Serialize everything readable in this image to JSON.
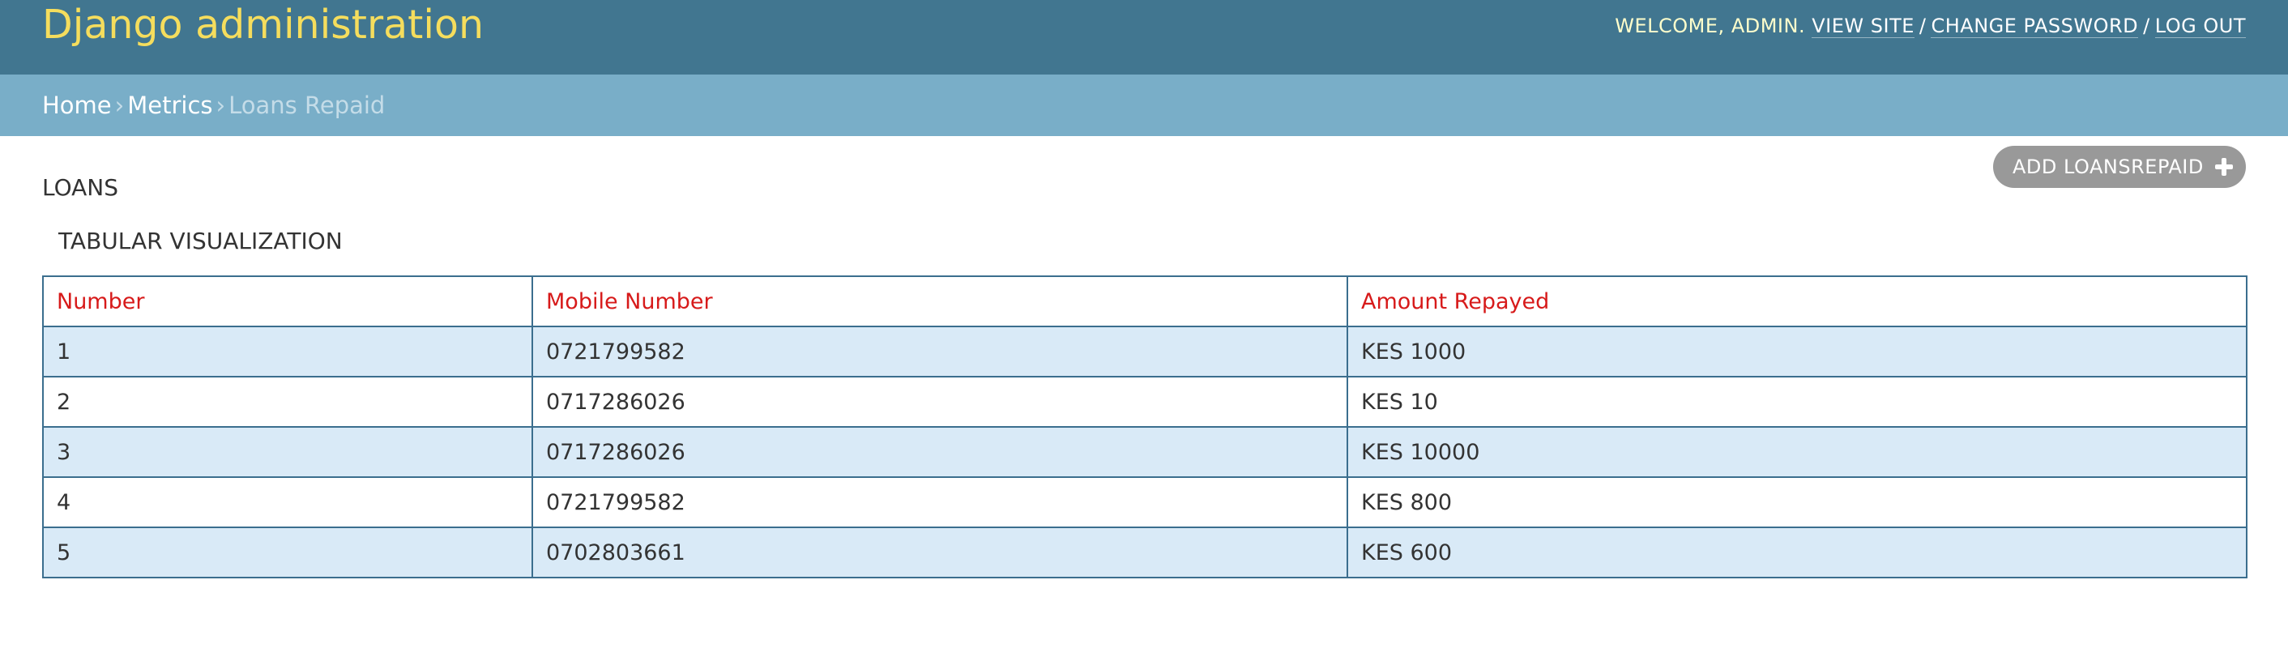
{
  "header": {
    "branding": "Django administration",
    "welcome": "WELCOME,",
    "username": "ADMIN.",
    "view_site": "VIEW SITE",
    "change_password": "CHANGE PASSWORD",
    "log_out": "LOG OUT",
    "separator": "/"
  },
  "breadcrumbs": {
    "home": "Home",
    "metrics": "Metrics",
    "current": "Loans Repaid",
    "separator": "›"
  },
  "toolbar": {
    "add_label": "ADD LOANSREPAID",
    "add_icon": "plus-icon"
  },
  "content": {
    "section_title": "LOANS",
    "sub_title": "TABULAR VISUALIZATION"
  },
  "table": {
    "headers": [
      "Number",
      "Mobile Number",
      "Amount Repayed"
    ],
    "rows": [
      [
        "1",
        "0721799582",
        "KES 1000"
      ],
      [
        "2",
        "0717286026",
        "KES 10"
      ],
      [
        "3",
        "0717286026",
        "KES 10000"
      ],
      [
        "4",
        "0721799582",
        "KES 800"
      ],
      [
        "5",
        "0702803661",
        "KES 600"
      ]
    ]
  },
  "colors": {
    "header_bg": "#417690",
    "brand": "#f5dd5d",
    "breadcrumb_bg": "#79aec8",
    "table_header_text": "#d71a1a",
    "row_stripe": "#d9eaf7",
    "table_border": "#3b6e8e",
    "button_bg": "#999999"
  }
}
